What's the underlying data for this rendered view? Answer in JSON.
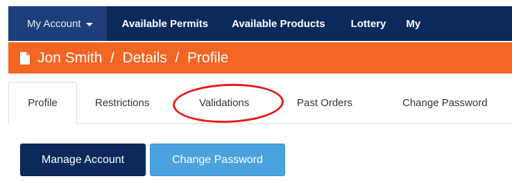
{
  "navbar": {
    "items": [
      {
        "label": "My Account"
      },
      {
        "label": "Available Permits"
      },
      {
        "label": "Available Products"
      },
      {
        "label": "Lottery"
      },
      {
        "label": "My"
      }
    ]
  },
  "breadcrumb": {
    "text": "Jon Smith  /  Details  /  Profile",
    "icon": "document-icon"
  },
  "tabs": [
    {
      "label": "Profile",
      "active": true
    },
    {
      "label": "Restrictions"
    },
    {
      "label": "Validations",
      "highlighted": true
    },
    {
      "label": "Past Orders"
    },
    {
      "label": "Change Password"
    }
  ],
  "buttons": {
    "manage_account": "Manage Account",
    "change_password": "Change Password"
  },
  "colors": {
    "navbar": "#0b2a5b",
    "navbar_active": "#1c3f7a",
    "breadcrumb_bar": "#f26522",
    "highlight": "#e51b1b",
    "primary_button": "#0b2a5b",
    "info_button": "#4aa3dd"
  }
}
